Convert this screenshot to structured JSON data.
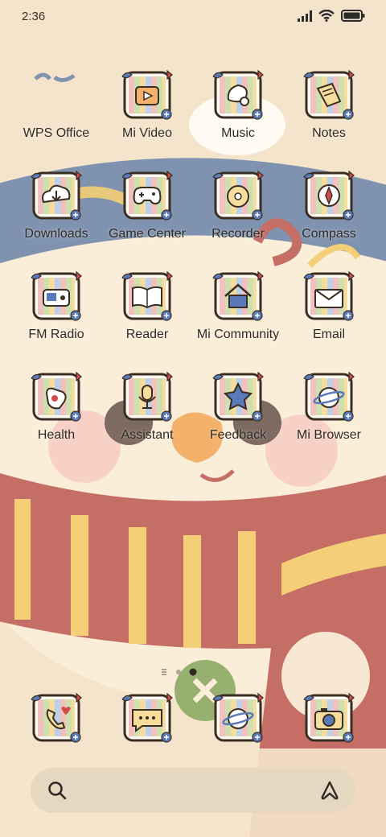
{
  "status": {
    "time": "2:36",
    "icons": [
      "signal-icon",
      "wifi-icon",
      "battery-icon"
    ]
  },
  "apps": [
    {
      "label": "WPS Office",
      "icon": "wps-office-icon"
    },
    {
      "label": "Mi Video",
      "icon": "mi-video-icon"
    },
    {
      "label": "Music",
      "icon": "music-icon"
    },
    {
      "label": "Notes",
      "icon": "notes-icon"
    },
    {
      "label": "Downloads",
      "icon": "downloads-icon"
    },
    {
      "label": "Game Center",
      "icon": "game-center-icon"
    },
    {
      "label": "Recorder",
      "icon": "recorder-icon"
    },
    {
      "label": "Compass",
      "icon": "compass-icon"
    },
    {
      "label": "FM Radio",
      "icon": "fm-radio-icon"
    },
    {
      "label": "Reader",
      "icon": "reader-icon"
    },
    {
      "label": "Mi Community",
      "icon": "mi-community-icon"
    },
    {
      "label": "Email",
      "icon": "email-icon"
    },
    {
      "label": "Health",
      "icon": "health-icon"
    },
    {
      "label": "Assistant",
      "icon": "assistant-icon"
    },
    {
      "label": "Feedback",
      "icon": "feedback-icon"
    },
    {
      "label": "Mi Browser",
      "icon": "mi-browser-icon"
    }
  ],
  "dock": [
    {
      "icon": "phone-icon"
    },
    {
      "icon": "messages-icon"
    },
    {
      "icon": "browser-icon"
    },
    {
      "icon": "camera-icon"
    }
  ],
  "pages": {
    "count": 2,
    "current": 2
  },
  "search": {
    "icons": [
      "search-icon",
      "assistant-logo-icon"
    ]
  },
  "colors": {
    "background": "#f5e6cf",
    "hat": "#7f93b0",
    "scarf": "#c46e66",
    "stripe": "#f4cf77",
    "icon_outline": "#3a2e22"
  }
}
